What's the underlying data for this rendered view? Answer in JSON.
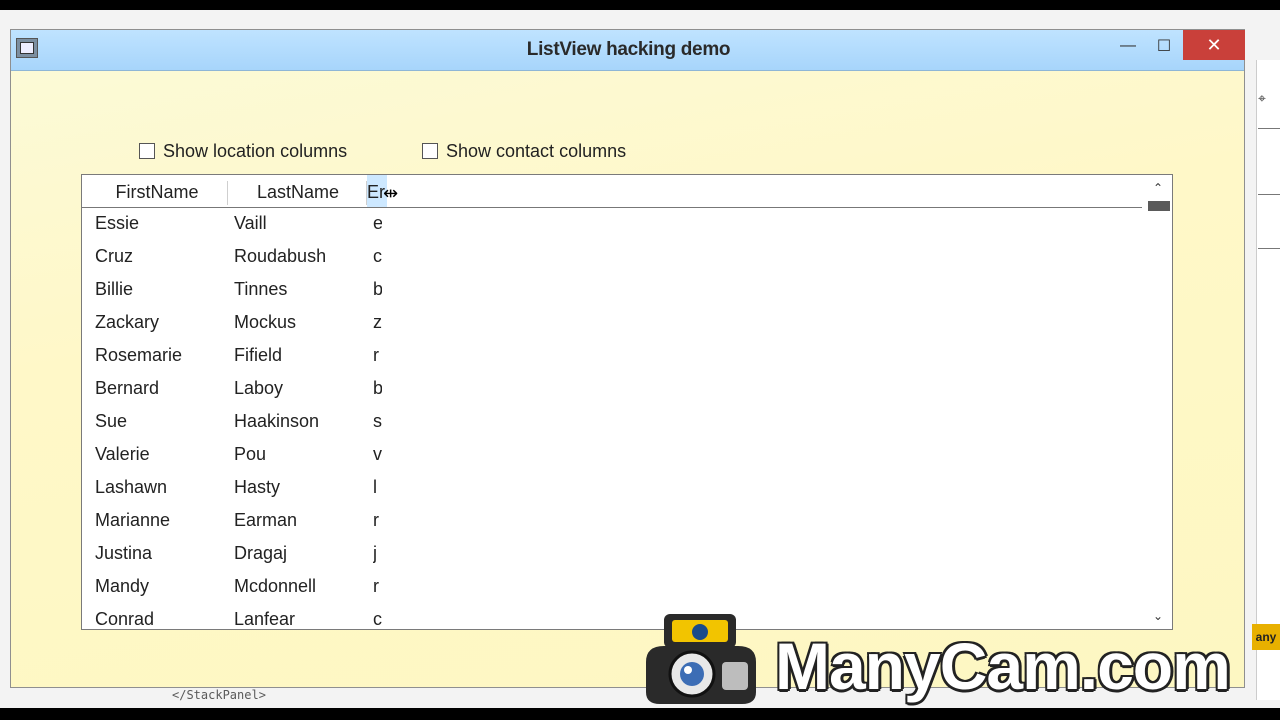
{
  "window": {
    "title": "ListView hacking demo",
    "controls": {
      "minimize": "—",
      "maximize": "☐",
      "close": "✕"
    }
  },
  "options": {
    "location": {
      "label": "Show location columns",
      "checked": false
    },
    "contact": {
      "label": "Show contact columns",
      "checked": false
    }
  },
  "listview": {
    "columns": [
      "FirstName",
      "LastName",
      "Er"
    ],
    "rows": [
      [
        "Essie",
        "Vaill",
        "e"
      ],
      [
        "Cruz",
        "Roudabush",
        "c"
      ],
      [
        "Billie",
        "Tinnes",
        "b"
      ],
      [
        "Zackary",
        "Mockus",
        "z"
      ],
      [
        "Rosemarie",
        "Fifield",
        "r"
      ],
      [
        "Bernard",
        "Laboy",
        "b"
      ],
      [
        "Sue",
        "Haakinson",
        "s"
      ],
      [
        "Valerie",
        "Pou",
        "v"
      ],
      [
        "Lashawn",
        "Hasty",
        "l"
      ],
      [
        "Marianne",
        "Earman",
        "r"
      ],
      [
        "Justina",
        "Dragaj",
        "j"
      ],
      [
        "Mandy",
        "Mcdonnell",
        "r"
      ],
      [
        "Conrad",
        "Lanfear",
        "c"
      ]
    ],
    "scroll_up": "⌃",
    "scroll_down": "⌄"
  },
  "background": {
    "code_snippet": "</StackPanel>",
    "badge": "any"
  },
  "watermark": "ManyCam.com",
  "colors": {
    "window_bg": "#fdf7c2",
    "titlebar": "#a7d5fb",
    "close_button": "#c9403a",
    "selected_header": "#cde8ff"
  }
}
